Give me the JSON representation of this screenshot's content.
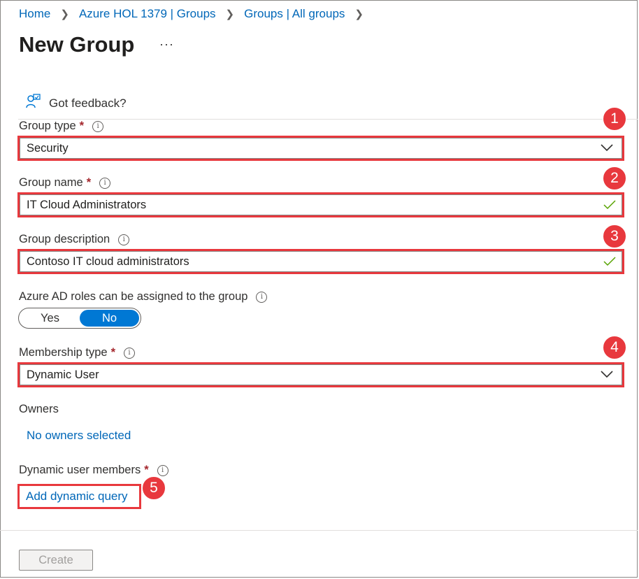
{
  "breadcrumb": [
    "Home",
    "Azure HOL 1379 | Groups",
    "Groups | All groups"
  ],
  "page": {
    "title": "New Group",
    "more": "···"
  },
  "feedback": {
    "label": "Got feedback?"
  },
  "group_type": {
    "label": "Group type",
    "required": "*",
    "value": "Security"
  },
  "group_name": {
    "label": "Group name",
    "required": "*",
    "value": "IT Cloud Administrators"
  },
  "group_description": {
    "label": "Group description",
    "value": "Contoso IT cloud administrators"
  },
  "azure_ad_roles": {
    "label": "Azure AD roles can be assigned to the group",
    "yes": "Yes",
    "no": "No",
    "selected": "No"
  },
  "membership_type": {
    "label": "Membership type",
    "required": "*",
    "value": "Dynamic User"
  },
  "owners": {
    "label": "Owners",
    "link": "No owners selected"
  },
  "dynamic_members": {
    "label": "Dynamic user members",
    "required": "*",
    "link": "Add dynamic query"
  },
  "badges": [
    "1",
    "2",
    "3",
    "4",
    "5"
  ],
  "actions": {
    "create": "Create"
  },
  "colors": {
    "accent": "#0078d4",
    "link": "#0067b8",
    "annotation": "#e8383d",
    "valid": "#57a300"
  }
}
